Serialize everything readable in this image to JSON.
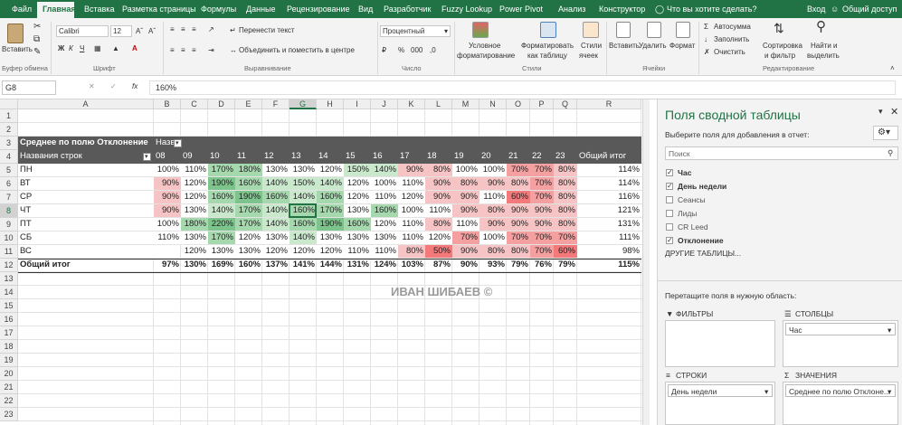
{
  "tabs": [
    "Файл",
    "Главная",
    "Вставка",
    "Разметка страницы",
    "Формулы",
    "Данные",
    "Рецензирование",
    "Вид",
    "Разработчик",
    "Fuzzy Lookup",
    "Power Pivot",
    "Анализ",
    "Конструктор"
  ],
  "tell_me": "Что вы хотите сделать?",
  "sign_in": "Вход",
  "share": "Общий доступ",
  "ribbon": {
    "paste": "Вставить",
    "clipboard": "Буфер обмена",
    "font_name": "Calibri",
    "font_size": "12",
    "font_group": "Шрифт",
    "wrap_text": "Перенести текст",
    "merge_center": "Объединить и поместить в центре",
    "alignment_group": "Выравнивание",
    "number_format": "Процентный",
    "number_group": "Число",
    "cond_format_1": "Условное",
    "cond_format_2": "форматирование",
    "format_table_1": "Форматировать",
    "format_table_2": "как таблицу",
    "cell_styles_1": "Стили",
    "cell_styles_2": "ячеек",
    "styles_group": "Стили",
    "insert": "Вставить",
    "delete": "Удалить",
    "format": "Формат",
    "cells_group": "Ячейки",
    "autosum": "Автосумма",
    "fill": "Заполнить",
    "clear": "Очистить",
    "sort_1": "Сортировка",
    "sort_2": "и фильтр",
    "find_1": "Найти и",
    "find_2": "выделить",
    "editing_group": "Редактирование"
  },
  "formula_bar": {
    "name_box": "G8",
    "fx": "fx",
    "value": "160%"
  },
  "columns": [
    "A",
    "B",
    "C",
    "D",
    "E",
    "F",
    "G",
    "H",
    "I",
    "J",
    "K",
    "L",
    "M",
    "N",
    "O",
    "P",
    "Q",
    "R"
  ],
  "rows": [
    "1",
    "2",
    "3",
    "4",
    "5",
    "6",
    "7",
    "8",
    "9",
    "10",
    "11",
    "12",
    "13",
    "14",
    "15",
    "16",
    "17",
    "18",
    "19",
    "20",
    "21",
    "22",
    "23"
  ],
  "pivot": {
    "title": "Среднее по полю Отклонение",
    "col_label": "Названия столбцов",
    "row_label": "Названия строк",
    "headers": [
      "08",
      "09",
      "10",
      "11",
      "12",
      "13",
      "14",
      "15",
      "16",
      "17",
      "18",
      "19",
      "20",
      "21",
      "22",
      "23",
      "Общий итог"
    ],
    "data": [
      {
        "name": "ПН",
        "values": [
          "100%",
          "110%",
          "170%",
          "180%",
          "130%",
          "130%",
          "120%",
          "150%",
          "140%",
          "90%",
          "80%",
          "100%",
          "100%",
          "70%",
          "70%",
          "80%",
          "114%"
        ]
      },
      {
        "name": "ВТ",
        "values": [
          "90%",
          "120%",
          "190%",
          "160%",
          "140%",
          "150%",
          "140%",
          "120%",
          "100%",
          "110%",
          "90%",
          "80%",
          "90%",
          "80%",
          "70%",
          "80%",
          "114%"
        ]
      },
      {
        "name": "СР",
        "values": [
          "90%",
          "120%",
          "160%",
          "190%",
          "160%",
          "140%",
          "160%",
          "120%",
          "110%",
          "120%",
          "90%",
          "90%",
          "110%",
          "60%",
          "70%",
          "80%",
          "116%"
        ]
      },
      {
        "name": "ЧТ",
        "values": [
          "90%",
          "130%",
          "140%",
          "170%",
          "140%",
          "160%",
          "170%",
          "130%",
          "160%",
          "100%",
          "110%",
          "90%",
          "80%",
          "90%",
          "90%",
          "80%",
          "121%"
        ]
      },
      {
        "name": "ПТ",
        "values": [
          "100%",
          "180%",
          "220%",
          "170%",
          "140%",
          "160%",
          "190%",
          "160%",
          "120%",
          "110%",
          "80%",
          "110%",
          "90%",
          "90%",
          "90%",
          "80%",
          "131%"
        ]
      },
      {
        "name": "СБ",
        "values": [
          "110%",
          "130%",
          "170%",
          "120%",
          "130%",
          "140%",
          "130%",
          "130%",
          "130%",
          "110%",
          "120%",
          "70%",
          "100%",
          "70%",
          "70%",
          "70%",
          "111%"
        ]
      },
      {
        "name": "ВС",
        "values": [
          "",
          "120%",
          "130%",
          "130%",
          "120%",
          "120%",
          "120%",
          "110%",
          "110%",
          "80%",
          "50%",
          "90%",
          "80%",
          "80%",
          "70%",
          "60%",
          "98%"
        ]
      }
    ],
    "total_label": "Общий итог",
    "totals": [
      "97%",
      "130%",
      "169%",
      "160%",
      "137%",
      "141%",
      "144%",
      "131%",
      "124%",
      "103%",
      "87%",
      "90%",
      "93%",
      "79%",
      "76%",
      "79%",
      "115%"
    ]
  },
  "watermark": "ИВАН ШИБАЕВ ©",
  "field_pane": {
    "title": "Поля сводной таблицы",
    "subtitle": "Выберите поля для добавления в отчет:",
    "search_placeholder": "Поиск",
    "fields": [
      {
        "label": "Час",
        "checked": true
      },
      {
        "label": "День недели",
        "checked": true
      },
      {
        "label": "Сеансы",
        "checked": false
      },
      {
        "label": "Лиды",
        "checked": false
      },
      {
        "label": "CR Leed",
        "checked": false
      },
      {
        "label": "Отклонение",
        "checked": true
      }
    ],
    "more_tables": "ДРУГИЕ ТАБЛИЦЫ...",
    "drag_hint": "Перетащите поля в нужную область:",
    "filters": "ФИЛЬТРЫ",
    "columns": "СТОЛБЦЫ",
    "columns_value": "Час",
    "rows": "СТРОКИ",
    "rows_value": "День недели",
    "values": "ЗНАЧЕНИЯ",
    "values_value": "Среднее по полю Отклоне..."
  },
  "colors": {
    "excel_green": "#217346",
    "heat_green": "#63be7b",
    "heat_red": "#f8696b",
    "pivot_header": "#595959"
  }
}
